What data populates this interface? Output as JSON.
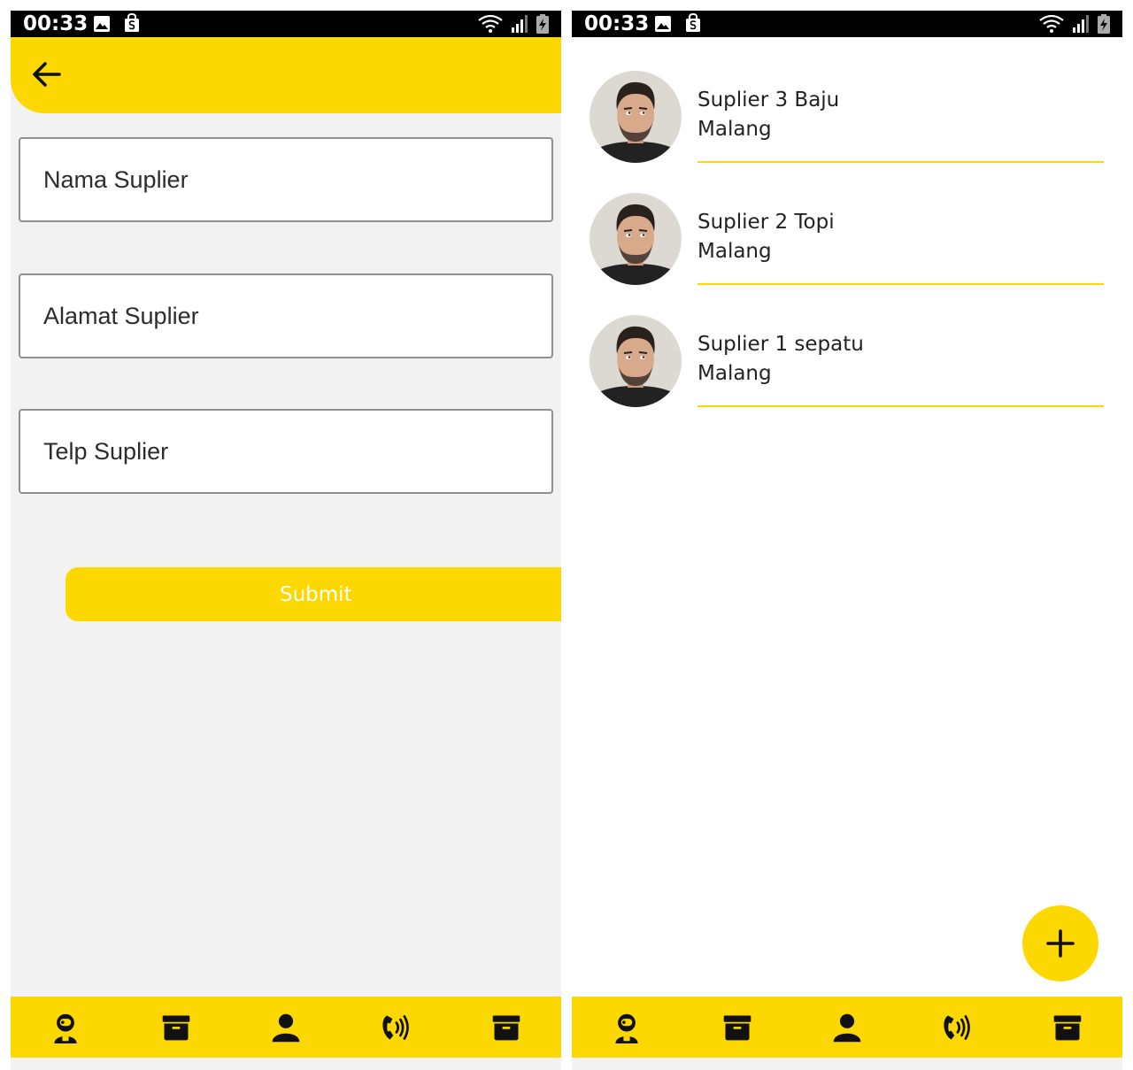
{
  "status_bar": {
    "time": "00:33"
  },
  "form_screen": {
    "fields": [
      {
        "placeholder": "Nama Suplier"
      },
      {
        "placeholder": "Alamat Suplier"
      },
      {
        "placeholder": "Telp Suplier"
      }
    ],
    "submit_label": "Submit"
  },
  "list_screen": {
    "items": [
      {
        "name": "Suplier 3 Baju",
        "city": "Malang"
      },
      {
        "name": "Suplier 2 Topi",
        "city": "Malang"
      },
      {
        "name": "Suplier 1 sepatu",
        "city": "Malang"
      }
    ]
  },
  "bottom_nav": {
    "icons": [
      "astronaut-icon",
      "archive-icon",
      "user-icon",
      "phone-volume-icon",
      "archive-icon"
    ]
  },
  "colors": {
    "accent": "#fcd800",
    "statusbar": "#000000",
    "form_background": "#f2f2f2"
  }
}
